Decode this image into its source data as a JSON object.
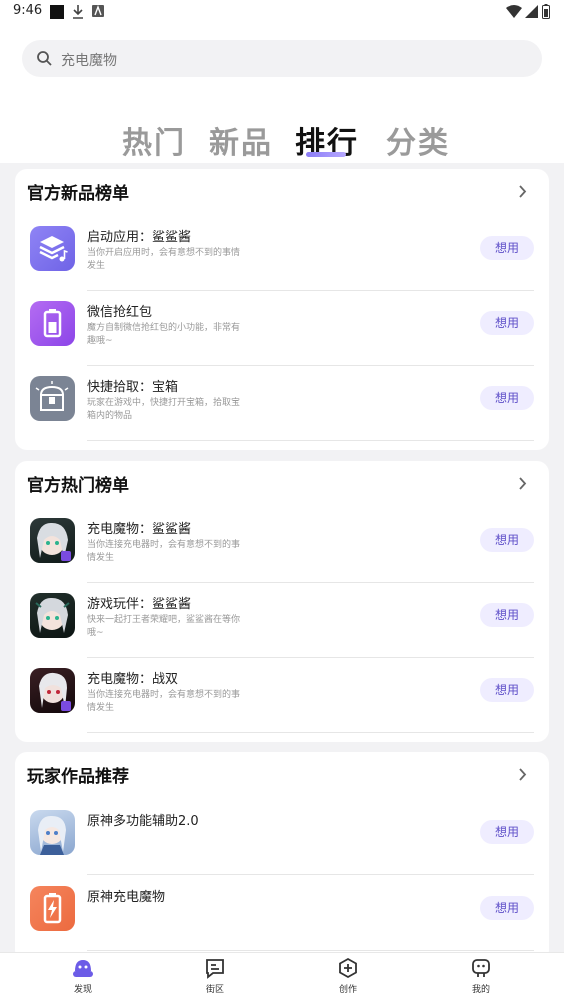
{
  "status": {
    "time": "9:46"
  },
  "search": {
    "placeholder": "充电魔物"
  },
  "tabs": [
    "热门",
    "新品",
    "排行",
    "分类"
  ],
  "active_tab": "排行",
  "sections": [
    {
      "title": "官方新品榜单",
      "items": [
        {
          "name": "启动应用：鲨鲨酱",
          "desc": "当你开启应用时，会有意想不到的事情发生",
          "button": "想用",
          "icon": "layers-music-icon"
        },
        {
          "name": "微信抢红包",
          "desc": "魔方自制微信抢红包的小功能，非常有趣哦~",
          "button": "想用",
          "icon": "battery-icon"
        },
        {
          "name": "快捷拾取：宝箱",
          "desc": "玩家在游戏中，快捷打开宝箱，拾取宝箱内的物品",
          "button": "想用",
          "icon": "treasure-chest-icon"
        }
      ]
    },
    {
      "title": "官方热门榜单",
      "items": [
        {
          "name": "充电魔物：鲨鲨酱",
          "desc": "当你连接充电器时，会有意想不到的事情发生",
          "button": "想用",
          "icon": "anime-girl-avatar-icon"
        },
        {
          "name": "游戏玩伴：鲨鲨酱",
          "desc": "快来一起打王者荣耀吧，鲨鲨酱在等你哦~",
          "button": "想用",
          "icon": "anime-girl-avatar-icon"
        },
        {
          "name": "充电魔物：战双",
          "desc": "当你连接充电器时，会有意想不到的事情发生",
          "button": "想用",
          "icon": "anime-girl-avatar-icon"
        }
      ]
    },
    {
      "title": "玩家作品推荐",
      "items": [
        {
          "name": "原神多功能辅助2.0",
          "desc": "",
          "button": "想用",
          "icon": "anime-character-avatar-icon"
        },
        {
          "name": "原神充电魔物",
          "desc": "",
          "button": "想用",
          "icon": "charging-bolt-icon"
        }
      ]
    }
  ],
  "bottom_nav": [
    {
      "label": "发现",
      "icon": "discover-icon",
      "active": true
    },
    {
      "label": "街区",
      "icon": "street-icon",
      "active": false
    },
    {
      "label": "创作",
      "icon": "create-plus-icon",
      "active": false
    },
    {
      "label": "我的",
      "icon": "profile-icon",
      "active": false
    }
  ],
  "colors": {
    "accent": "#6c5ce7",
    "button_bg": "#efedff",
    "button_text": "#5f50c9"
  }
}
